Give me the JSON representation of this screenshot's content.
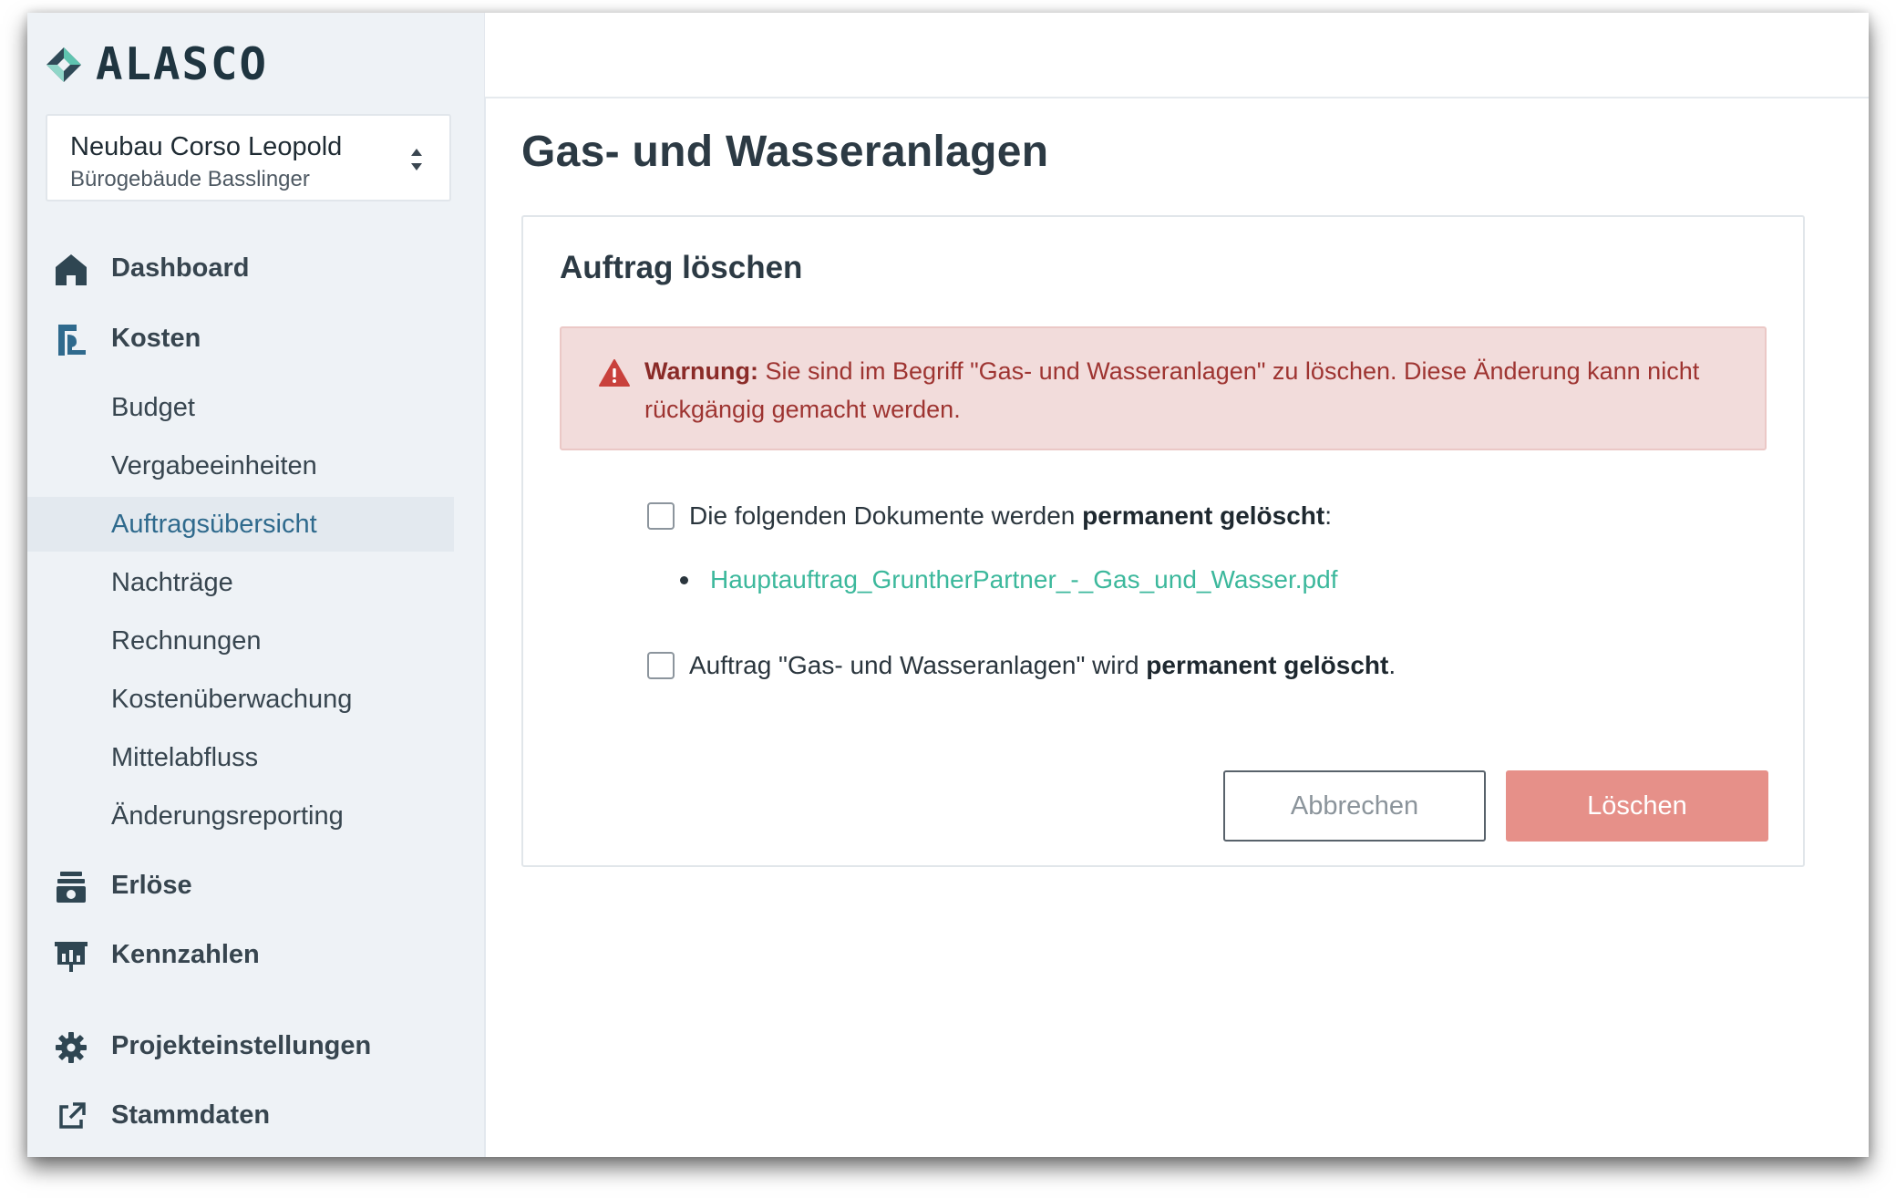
{
  "brand": {
    "logo_text": "ALASCO"
  },
  "project": {
    "name": "Neubau Corso Leopold",
    "building": "Bürogebäude Basslinger"
  },
  "sidebar": {
    "dashboard": "Dashboard",
    "kosten": "Kosten",
    "sub_items": [
      "Budget",
      "Vergabeeinheiten",
      "Auftragsübersicht",
      "Nachträge",
      "Rechnungen",
      "Kostenüberwachung",
      "Mittelabfluss",
      "Änderungsreporting"
    ],
    "active_sub_item": "Auftragsübersicht",
    "erloese": "Erlöse",
    "kennzahlen": "Kennzahlen",
    "projekteinstellungen": "Projekteinstellungen",
    "stammdaten": "Stammdaten"
  },
  "main": {
    "page_title": "Gas- und Wasseranlagen",
    "card_title": "Auftrag löschen",
    "alert": {
      "label": "Warnung:",
      "message": "Sie sind im Begriff \"Gas- und Wasseranlagen\" zu löschen. Diese Änderung kann nicht rückgängig gemacht werden."
    },
    "check_documents": {
      "prefix": "Die folgenden Dokumente werden",
      "emphasis": "permanent gelöscht",
      "suffix": ":",
      "checked": false
    },
    "documents": [
      "Hauptauftrag_GruntherPartner_-_Gas_und_Wasser.pdf"
    ],
    "check_order": {
      "prefix": "Auftrag \"Gas- und Wasseranlagen\" wird",
      "emphasis": "permanent gelöscht",
      "suffix": ".",
      "checked": false
    },
    "cancel_label": "Abbrechen",
    "delete_label": "Löschen"
  },
  "colors": {
    "sidebar_bg": "#eef2f6",
    "active_text": "#2f6a8d",
    "alert_bg": "#f2dcdb",
    "alert_text": "#9e3431",
    "link": "#3cb89c",
    "delete_button": "#e69089"
  }
}
